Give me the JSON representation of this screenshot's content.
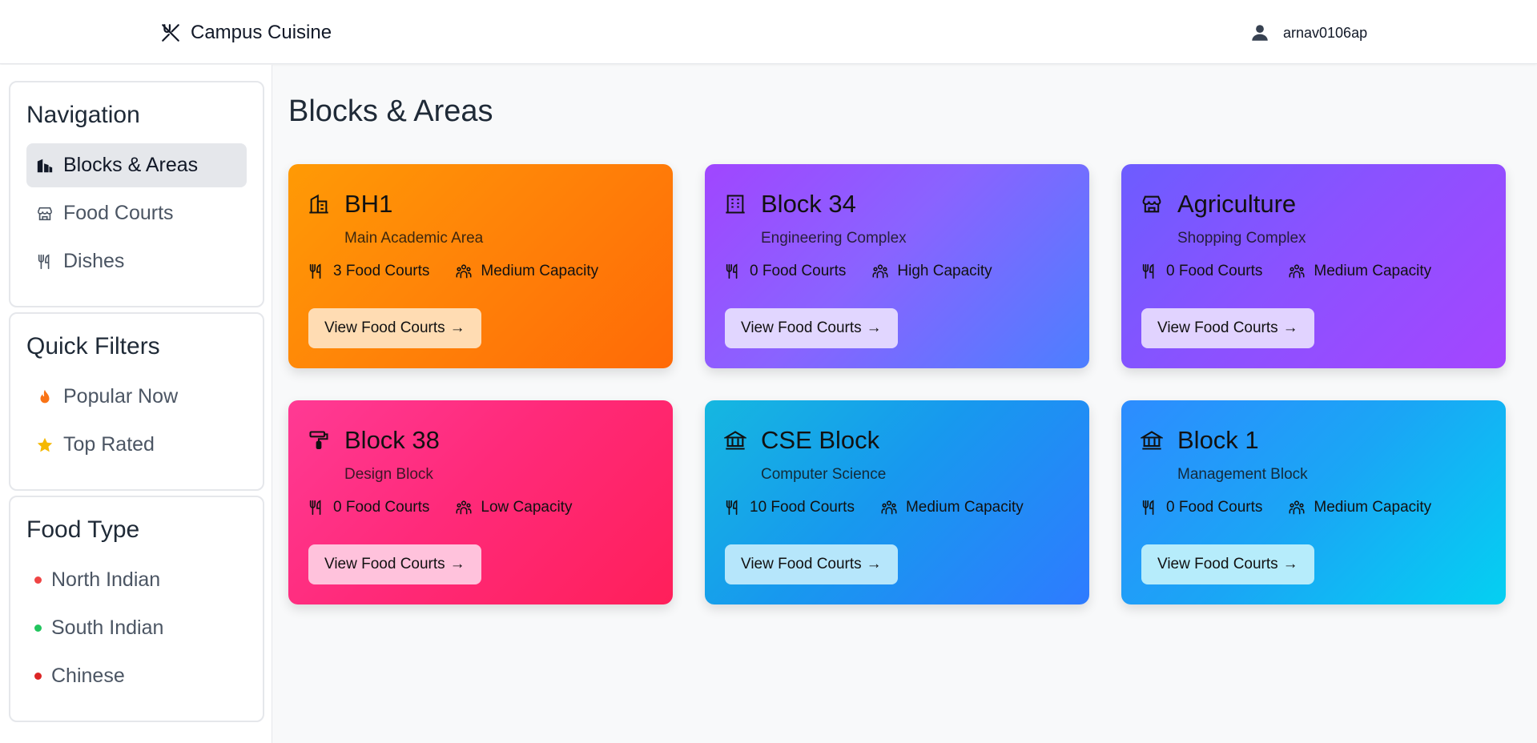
{
  "header": {
    "brand_icon": "fork-knife-icon",
    "brand_name": "Campus Cuisine",
    "user_icon": "user-icon",
    "username": "arnav0106ap"
  },
  "sidebar": {
    "navigation": {
      "title": "Navigation",
      "items": [
        {
          "label": "Blocks & Areas",
          "icon": "building-icon",
          "active": true
        },
        {
          "label": "Food Courts",
          "icon": "store-icon",
          "active": false
        },
        {
          "label": "Dishes",
          "icon": "utensils-icon",
          "active": false
        }
      ]
    },
    "quick_filters": {
      "title": "Quick Filters",
      "items": [
        {
          "label": "Popular Now",
          "icon": "fire-icon",
          "color": "#f97316"
        },
        {
          "label": "Top Rated",
          "icon": "star-icon",
          "color": "#f5b800"
        }
      ]
    },
    "food_type": {
      "title": "Food Type",
      "items": [
        {
          "label": "North Indian",
          "dot_color": "#ef4444"
        },
        {
          "label": "South Indian",
          "dot_color": "#22c55e"
        },
        {
          "label": "Chinese",
          "dot_color": "#dc2626"
        }
      ]
    }
  },
  "main": {
    "title": "Blocks & Areas",
    "cards": [
      {
        "title": "BH1",
        "subtitle": "Main Academic Area",
        "food_courts": "3 Food Courts",
        "capacity": "Medium Capacity",
        "button": "View Food Courts",
        "icon": "building-icon",
        "button_bg": "#ffdcb3"
      },
      {
        "title": "Block 34",
        "subtitle": "Engineering Complex",
        "food_courts": "0 Food Courts",
        "capacity": "High Capacity",
        "button": "View Food Courts",
        "icon": "office-building-icon",
        "button_bg": "#e1d6ff"
      },
      {
        "title": "Agriculture",
        "subtitle": "Shopping Complex",
        "food_courts": "0 Food Courts",
        "capacity": "Medium Capacity",
        "button": "View Food Courts",
        "icon": "store-icon",
        "button_bg": "#e1d3ff"
      },
      {
        "title": "Block 38",
        "subtitle": "Design Block",
        "food_courts": "0 Food Courts",
        "capacity": "Low Capacity",
        "button": "View Food Courts",
        "icon": "paint-roller-icon",
        "button_bg": "#ffc2dc"
      },
      {
        "title": "CSE Block",
        "subtitle": "Computer Science",
        "food_courts": "10 Food Courts",
        "capacity": "Medium Capacity",
        "button": "View Food Courts",
        "icon": "institution-icon",
        "button_bg": "#b6e6fb"
      },
      {
        "title": "Block 1",
        "subtitle": "Management Block",
        "food_courts": "0 Food Courts",
        "capacity": "Medium Capacity",
        "button": "View Food Courts",
        "icon": "institution-icon",
        "button_bg": "#b6ecfb"
      }
    ]
  }
}
